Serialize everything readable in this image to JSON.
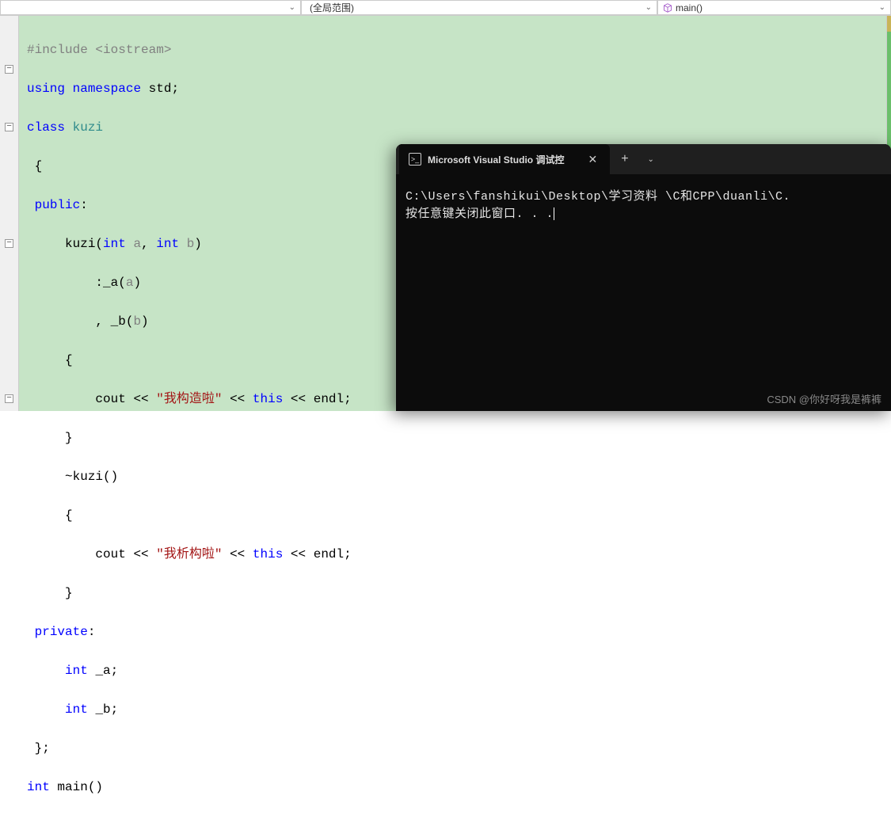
{
  "top": {
    "scope": "(全局范围)",
    "func": "main()"
  },
  "code": {
    "include": "#include",
    "iostream": "<iostream>",
    "using": "using",
    "namespace": "namespace",
    "std": "std",
    "semicolon": ";",
    "class": "class",
    "kuzi": "kuzi",
    "lbrace": "{",
    "rbrace": "}",
    "public": "public",
    "colon": ":",
    "int_kw": "int",
    "a": "a",
    "b": "b",
    "comma": ", ",
    "lparen": "(",
    "rparen": ")",
    "init_a": ":_a",
    "init_b": ", _b",
    "cout": "cout",
    "lshift": "<<",
    "str_ctor": "\"我构造啦\"",
    "str_dtor": "\"我析构啦\"",
    "this": "this",
    "endl": "endl",
    "tilde_kuzi": "~kuzi",
    "empty_args": "()",
    "private": "private",
    "field_a": "_a",
    "field_b": "_b",
    "rbrace_semi": "};",
    "main": "main"
  },
  "terminal": {
    "tab_title": "Microsoft Visual Studio 调试控",
    "line1": "C:\\Users\\fanshikui\\Desktop\\学习资料 \\C和CPP\\duanli\\C.",
    "line2": "按任意键关闭此窗口. . ."
  },
  "watermark": "CSDN @你好呀我是裤裤",
  "fold": {
    "minus": "−"
  }
}
